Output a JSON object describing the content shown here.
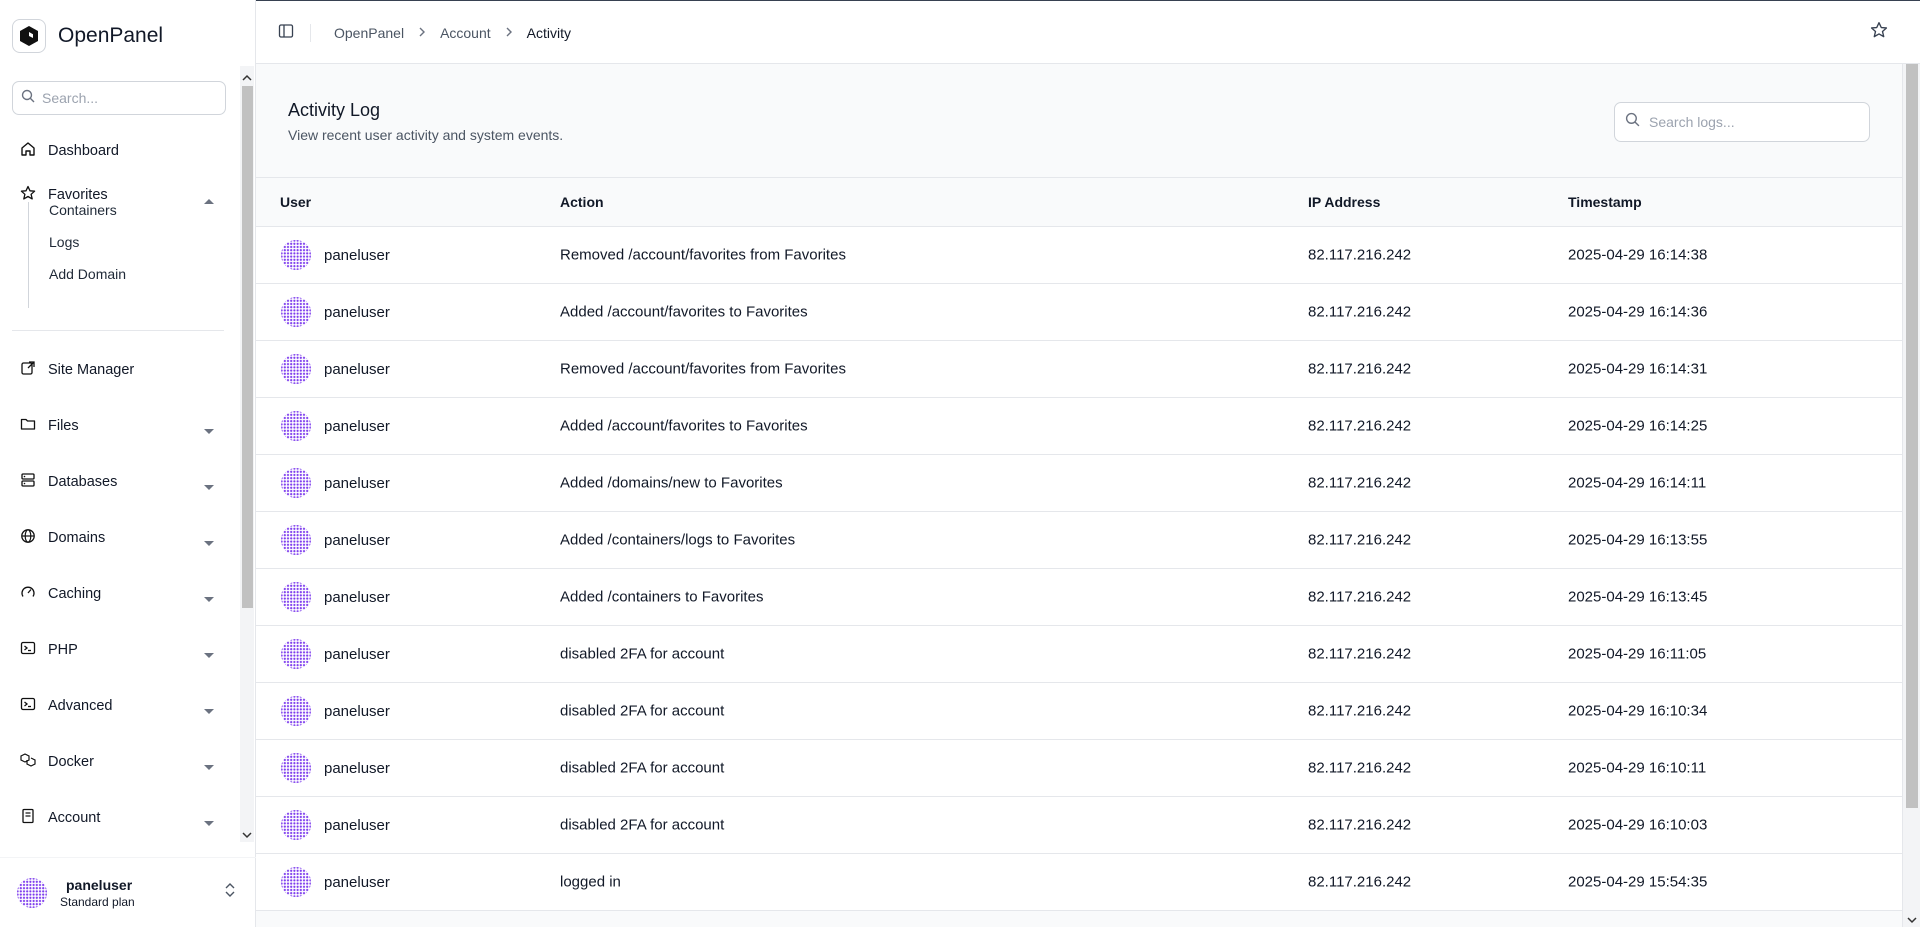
{
  "app": {
    "name": "OpenPanel"
  },
  "sidebar": {
    "search_placeholder": "Search...",
    "nav": {
      "dashboard": "Dashboard",
      "favorites": "Favorites",
      "site_manager": "Site Manager",
      "files": "Files",
      "databases": "Databases",
      "domains": "Domains",
      "caching": "Caching",
      "php": "PHP",
      "advanced": "Advanced",
      "docker": "Docker",
      "account": "Account"
    },
    "favorites_items": [
      "Containers",
      "Logs",
      "Add Domain"
    ],
    "user": {
      "name": "paneluser",
      "plan": "Standard plan"
    }
  },
  "breadcrumb": [
    "OpenPanel",
    "Account",
    "Activity"
  ],
  "page": {
    "title": "Activity Log",
    "subtitle": "View recent user activity and system events.",
    "search_placeholder": "Search logs..."
  },
  "table": {
    "columns": [
      "User",
      "Action",
      "IP Address",
      "Timestamp"
    ],
    "rows": [
      {
        "user": "paneluser",
        "action": "Removed /account/favorites from Favorites",
        "ip": "82.117.216.242",
        "timestamp": "2025-04-29 16:14:38"
      },
      {
        "user": "paneluser",
        "action": "Added /account/favorites to Favorites",
        "ip": "82.117.216.242",
        "timestamp": "2025-04-29 16:14:36"
      },
      {
        "user": "paneluser",
        "action": "Removed /account/favorites from Favorites",
        "ip": "82.117.216.242",
        "timestamp": "2025-04-29 16:14:31"
      },
      {
        "user": "paneluser",
        "action": "Added /account/favorites to Favorites",
        "ip": "82.117.216.242",
        "timestamp": "2025-04-29 16:14:25"
      },
      {
        "user": "paneluser",
        "action": "Added /domains/new to Favorites",
        "ip": "82.117.216.242",
        "timestamp": "2025-04-29 16:14:11"
      },
      {
        "user": "paneluser",
        "action": "Added /containers/logs to Favorites",
        "ip": "82.117.216.242",
        "timestamp": "2025-04-29 16:13:55"
      },
      {
        "user": "paneluser",
        "action": "Added /containers to Favorites",
        "ip": "82.117.216.242",
        "timestamp": "2025-04-29 16:13:45"
      },
      {
        "user": "paneluser",
        "action": "disabled 2FA for account",
        "ip": "82.117.216.242",
        "timestamp": "2025-04-29 16:11:05"
      },
      {
        "user": "paneluser",
        "action": "disabled 2FA for account",
        "ip": "82.117.216.242",
        "timestamp": "2025-04-29 16:10:34"
      },
      {
        "user": "paneluser",
        "action": "disabled 2FA for account",
        "ip": "82.117.216.242",
        "timestamp": "2025-04-29 16:10:11"
      },
      {
        "user": "paneluser",
        "action": "disabled 2FA for account",
        "ip": "82.117.216.242",
        "timestamp": "2025-04-29 16:10:03"
      },
      {
        "user": "paneluser",
        "action": "logged in",
        "ip": "82.117.216.242",
        "timestamp": "2025-04-29 15:54:35"
      }
    ]
  },
  "colors": {
    "avatar": "#7c3aed",
    "border": "#e5e7eb",
    "text": "#111827",
    "muted": "#4b5563"
  }
}
